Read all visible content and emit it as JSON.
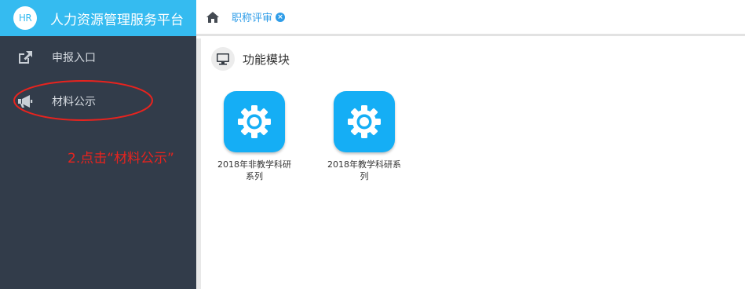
{
  "header": {
    "logo_text": "HR",
    "app_title": "人力资源管理服务平台",
    "home_icon": "home-icon",
    "tab_label": "职称评审",
    "tab_close_glyph": "×"
  },
  "sidebar": {
    "items": [
      {
        "label": "申报入口",
        "icon": "external-link-icon"
      },
      {
        "label": "材料公示",
        "icon": "megaphone-icon"
      }
    ]
  },
  "main": {
    "section_icon": "monitor-icon",
    "section_title": "功能模块",
    "modules": [
      {
        "label": "2018年非教学科研系列",
        "icon": "gear-icon"
      },
      {
        "label": "2018年教学科研系列",
        "icon": "gear-icon"
      }
    ]
  },
  "annotation": {
    "text": "2.点击“材料公示”",
    "color": "#e8231e"
  },
  "colors": {
    "brand": "#35bbf0",
    "sidebar": "#323c4a",
    "tile": "#15aef5",
    "tab_text": "#2f9de8"
  }
}
